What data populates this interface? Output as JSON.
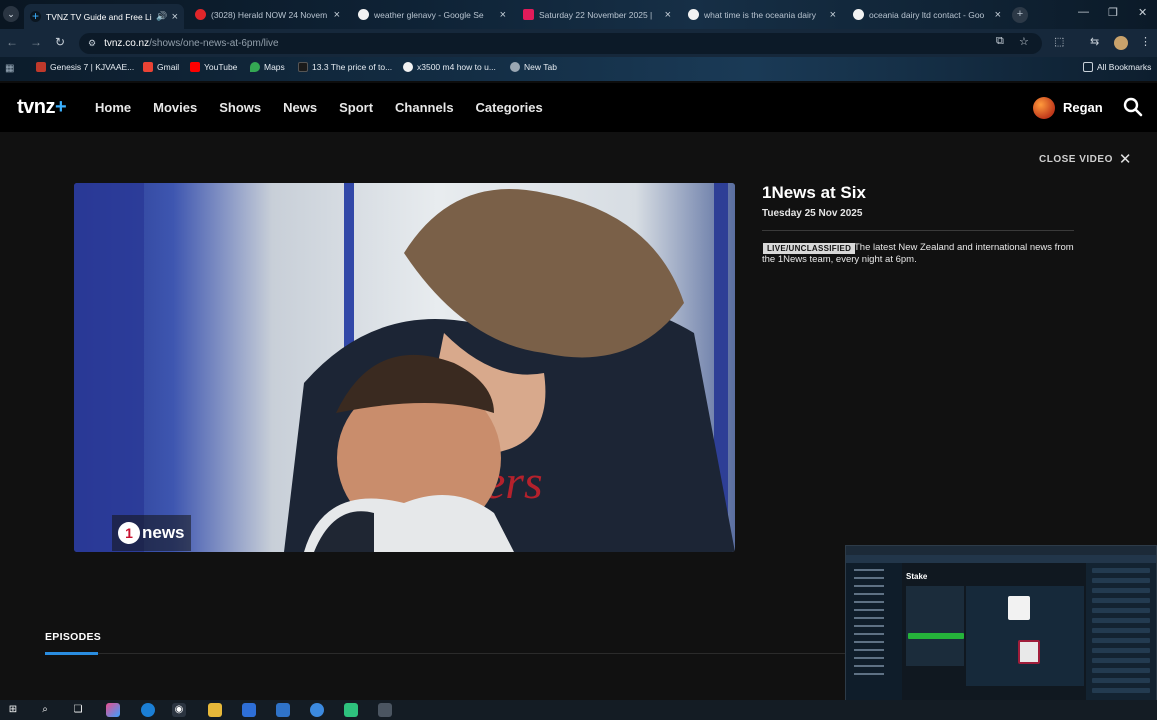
{
  "browser": {
    "tabs": [
      {
        "title": "TVNZ TV Guide and Free Li",
        "active": true,
        "favicon_color": "#3bb1ff"
      },
      {
        "title": "(3028) Herald NOW 24 Novem",
        "active": false,
        "favicon_color": "#e0262a"
      },
      {
        "title": "weather glenavy - Google Se",
        "active": false,
        "favicon_color": "#f2f2f2"
      },
      {
        "title": "Saturday 22 November 2025 |",
        "active": false,
        "favicon_color": "#e21b5a"
      },
      {
        "title": "what time is the oceania dairy",
        "active": false,
        "favicon_color": "#f2f2f2"
      },
      {
        "title": "oceania dairy ltd contact - Goo",
        "active": false,
        "favicon_color": "#f2f2f2"
      }
    ],
    "url_host": "tvnz.co.nz",
    "url_path": "/shows/one-news-at-6pm/live",
    "bookmarks": [
      {
        "label": "Genesis 7 | KJVAAE...",
        "color": "#c0392b"
      },
      {
        "label": "Gmail",
        "color": "#ea4335"
      },
      {
        "label": "YouTube",
        "color": "#ff0000"
      },
      {
        "label": "Maps",
        "color": "#34a853"
      },
      {
        "label": "13.3 The price of to...",
        "color": "#1a1a1a"
      },
      {
        "label": "x3500 m4 how to u...",
        "color": "#f2f2f2"
      },
      {
        "label": "New Tab",
        "color": "#9aa7b3"
      }
    ],
    "all_bookmarks": "All Bookmarks"
  },
  "site": {
    "logo_text": "tvnz",
    "logo_plus": "+",
    "nav": [
      "Home",
      "Movies",
      "Shows",
      "News",
      "Sport",
      "Channels",
      "Categories"
    ],
    "user_name": "Regan",
    "accent_color": "#3bb1ff"
  },
  "main": {
    "close_video": "CLOSE VIDEO",
    "show_title": "1News at Six",
    "show_date": "Tuesday 25 Nov 2025",
    "badge": "LIVE/UNCLASSIFIED",
    "description": "The latest New Zealand and international news from the 1News team, every night at 6pm.",
    "watermark_one": "1",
    "watermark_text": "news",
    "episodes_label": "EPISODES"
  },
  "pip": {
    "title": "Stake"
  }
}
